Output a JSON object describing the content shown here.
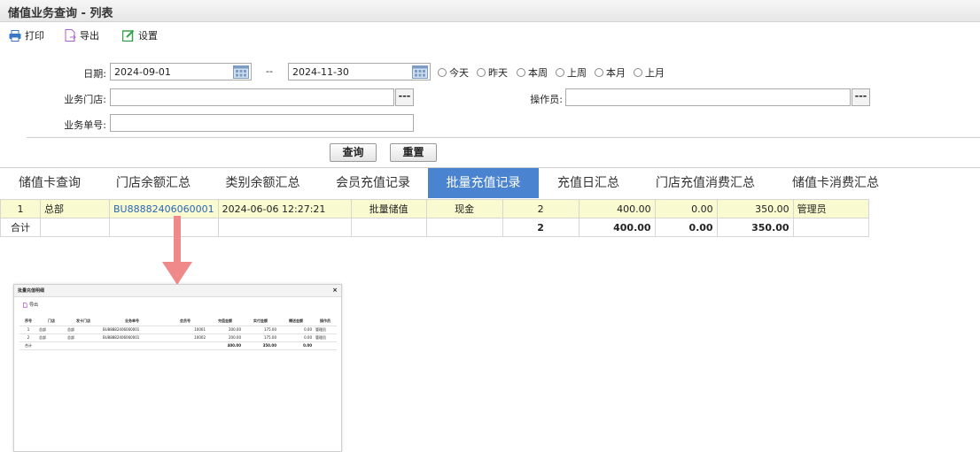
{
  "title": "储值业务查询 - 列表",
  "toolbar": {
    "print": "打印",
    "export": "导出",
    "settings": "设置"
  },
  "filters": {
    "date_label": "日期:",
    "date_from": "2024-09-01",
    "date_sep": "--",
    "date_to": "2024-11-30",
    "quick_ranges": [
      "今天",
      "昨天",
      "本周",
      "上周",
      "本月",
      "上月"
    ],
    "store_label": "业务门店:",
    "store_value": "",
    "operator_label": "操作员:",
    "operator_value": "",
    "order_label": "业务单号:",
    "order_value": "",
    "dots": "---"
  },
  "actions": {
    "query": "查询",
    "reset": "重置"
  },
  "tabs": [
    "储值卡查询",
    "门店余额汇总",
    "类别余额汇总",
    "会员充值记录",
    "批量充值记录",
    "充值日汇总",
    "门店充值消费汇总",
    "储值卡消费汇总"
  ],
  "active_tab": "批量充值记录",
  "grid": {
    "rows": [
      {
        "no": "1",
        "store": "总部",
        "order_no": "BU88882406060001",
        "time": "2024-06-06 12:27:21",
        "type": "批量储值",
        "pay": "现金",
        "count": "2",
        "amount": "400.00",
        "gift": "0.00",
        "balance": "350.00",
        "operator": "管理员"
      }
    ],
    "summary": {
      "label": "合计",
      "count": "2",
      "amount": "400.00",
      "gift": "0.00",
      "balance": "350.00"
    }
  },
  "detail_popup": {
    "title": "批量充值明细",
    "close": "×",
    "export": "导出",
    "headers": [
      "序号",
      "门店",
      "发卡门店",
      "业务单号",
      "会员号",
      "充值金额",
      "实付金额",
      "赠送金额",
      "操作员"
    ],
    "rows": [
      [
        "1",
        "总部",
        "总部",
        "BU88882406060001",
        "10001",
        "200.00",
        "175.00",
        "0.00",
        "管理员"
      ],
      [
        "2",
        "总部",
        "总部",
        "BU88882406060001",
        "10002",
        "200.00",
        "175.00",
        "0.00",
        "管理员"
      ]
    ],
    "summary": [
      "合计",
      "",
      "",
      "",
      "",
      "400.00",
      "350.00",
      "0.00",
      ""
    ]
  },
  "colors": {
    "accent": "#4a84d0",
    "row_highlight": "#fafad0",
    "arrow": "#f08a8a",
    "link": "#2a66b8"
  },
  "icons": {
    "print": "printer-icon",
    "export": "export-file-icon",
    "settings": "edit-settings-icon",
    "calendar": "calendar-icon"
  }
}
